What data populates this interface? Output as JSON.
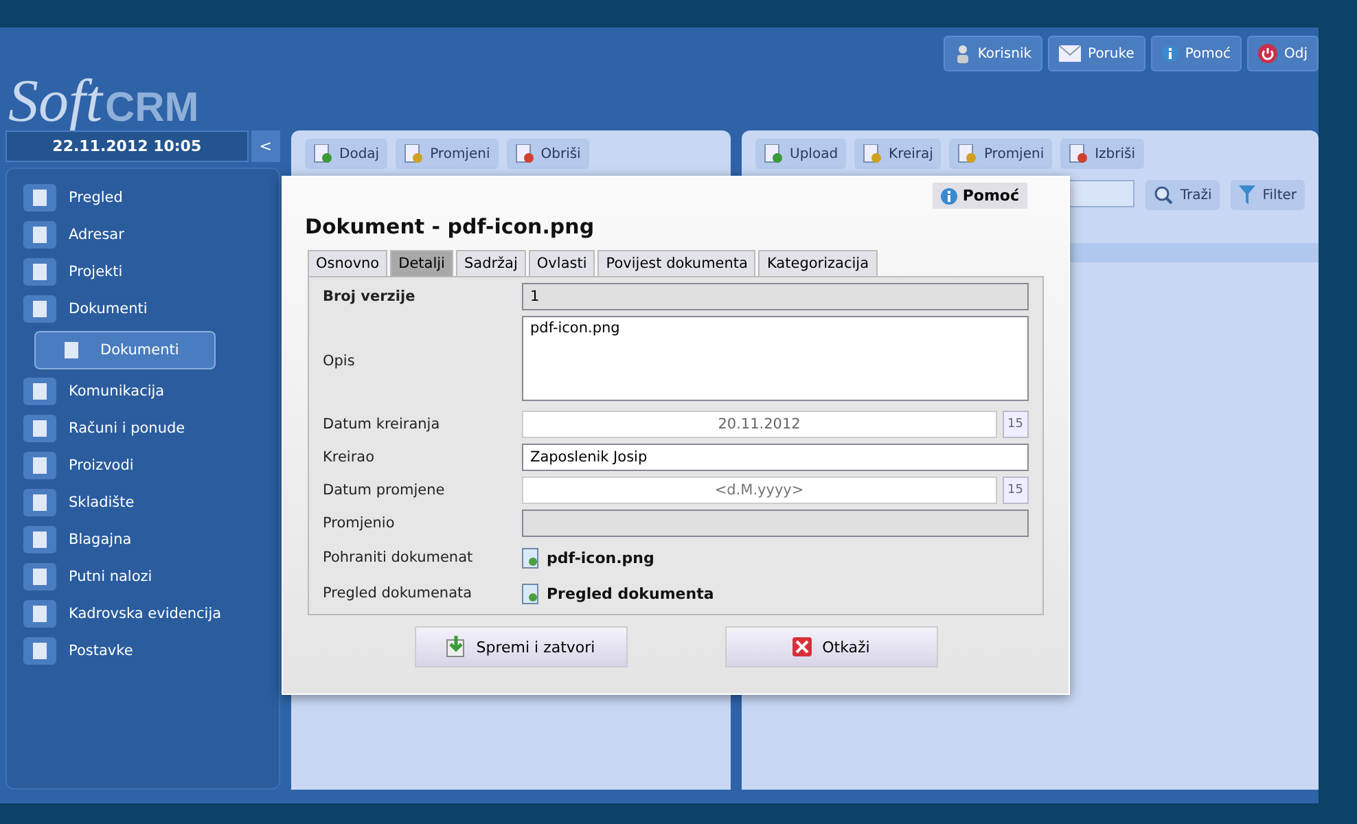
{
  "header": {
    "logo": {
      "script": "Soft",
      "bold": "CRM"
    },
    "top_buttons": [
      {
        "label": "Korisnik",
        "kind": "user"
      },
      {
        "label": "Poruke",
        "kind": "mail"
      },
      {
        "label": "Pomoć",
        "kind": "info"
      },
      {
        "label": "Odj",
        "kind": "power"
      }
    ]
  },
  "sidebar": {
    "datetime": "22.11.2012 10:05",
    "collapse": "<",
    "items": [
      {
        "label": "Pregled",
        "selected": false
      },
      {
        "label": "Adresar",
        "selected": false
      },
      {
        "label": "Projekti",
        "selected": false
      },
      {
        "label": "Dokumenti",
        "selected": false,
        "children": [
          {
            "label": "Dokumenti",
            "selected": true
          }
        ]
      },
      {
        "label": "Komunikacija",
        "selected": false
      },
      {
        "label": "Računi i ponude",
        "selected": false
      },
      {
        "label": "Proizvodi",
        "selected": false
      },
      {
        "label": "Skladište",
        "selected": false
      },
      {
        "label": "Blagajna",
        "selected": false
      },
      {
        "label": "Putni nalozi",
        "selected": false
      },
      {
        "label": "Kadrovska evidencija",
        "selected": false
      },
      {
        "label": "Postavke",
        "selected": false
      }
    ]
  },
  "left_panel": {
    "toolbar": [
      {
        "label": "Dodaj",
        "kind": "add"
      },
      {
        "label": "Promjeni",
        "kind": "edit"
      },
      {
        "label": "Obriši",
        "kind": "delete"
      }
    ]
  },
  "right_panel": {
    "toolbar": [
      {
        "label": "Upload",
        "kind": "add"
      },
      {
        "label": "Kreiraj",
        "kind": "edit"
      },
      {
        "label": "Promjeni",
        "kind": "edit"
      },
      {
        "label": "Izbriši",
        "kind": "delete"
      }
    ],
    "search_button": "Traži",
    "filter_button": "Filter"
  },
  "dialog": {
    "help": "Pomoć",
    "title": "Dokument - pdf-icon.png",
    "tabs": [
      {
        "label": "Osnovno",
        "selected": false
      },
      {
        "label": "Detalji",
        "selected": true
      },
      {
        "label": "Sadržaj",
        "selected": false
      },
      {
        "label": "Ovlasti",
        "selected": false
      },
      {
        "label": "Povijest dokumenta",
        "selected": false
      },
      {
        "label": "Kategorizacija",
        "selected": false
      }
    ],
    "fields": [
      {
        "label": "Broj verzije",
        "strong": true,
        "kind": "readonly",
        "value": "1"
      },
      {
        "label": "Opis",
        "strong": false,
        "kind": "textarea",
        "value": "pdf-icon.png"
      },
      {
        "label": "Datum kreiranja",
        "strong": false,
        "kind": "date",
        "value": "20.11.2012",
        "calendar": "15"
      },
      {
        "label": "Kreirao",
        "strong": false,
        "kind": "text",
        "value": "Zaposlenik Josip"
      },
      {
        "label": "Datum promjene",
        "strong": false,
        "kind": "date",
        "placeholder": "<d.M.yyyy>",
        "calendar": "15"
      },
      {
        "label": "Promjenio",
        "strong": false,
        "kind": "readonly"
      },
      {
        "label": "Pohraniti dokumenat",
        "strong": false,
        "kind": "link",
        "value": "pdf-icon.png"
      },
      {
        "label": "Pregled dokumenata",
        "strong": false,
        "kind": "link",
        "value": "Pregled dokumenta"
      }
    ],
    "buttons": [
      {
        "label": "Spremi i zatvori",
        "kind": "save"
      },
      {
        "label": "Otkaži",
        "kind": "cancel"
      }
    ]
  }
}
